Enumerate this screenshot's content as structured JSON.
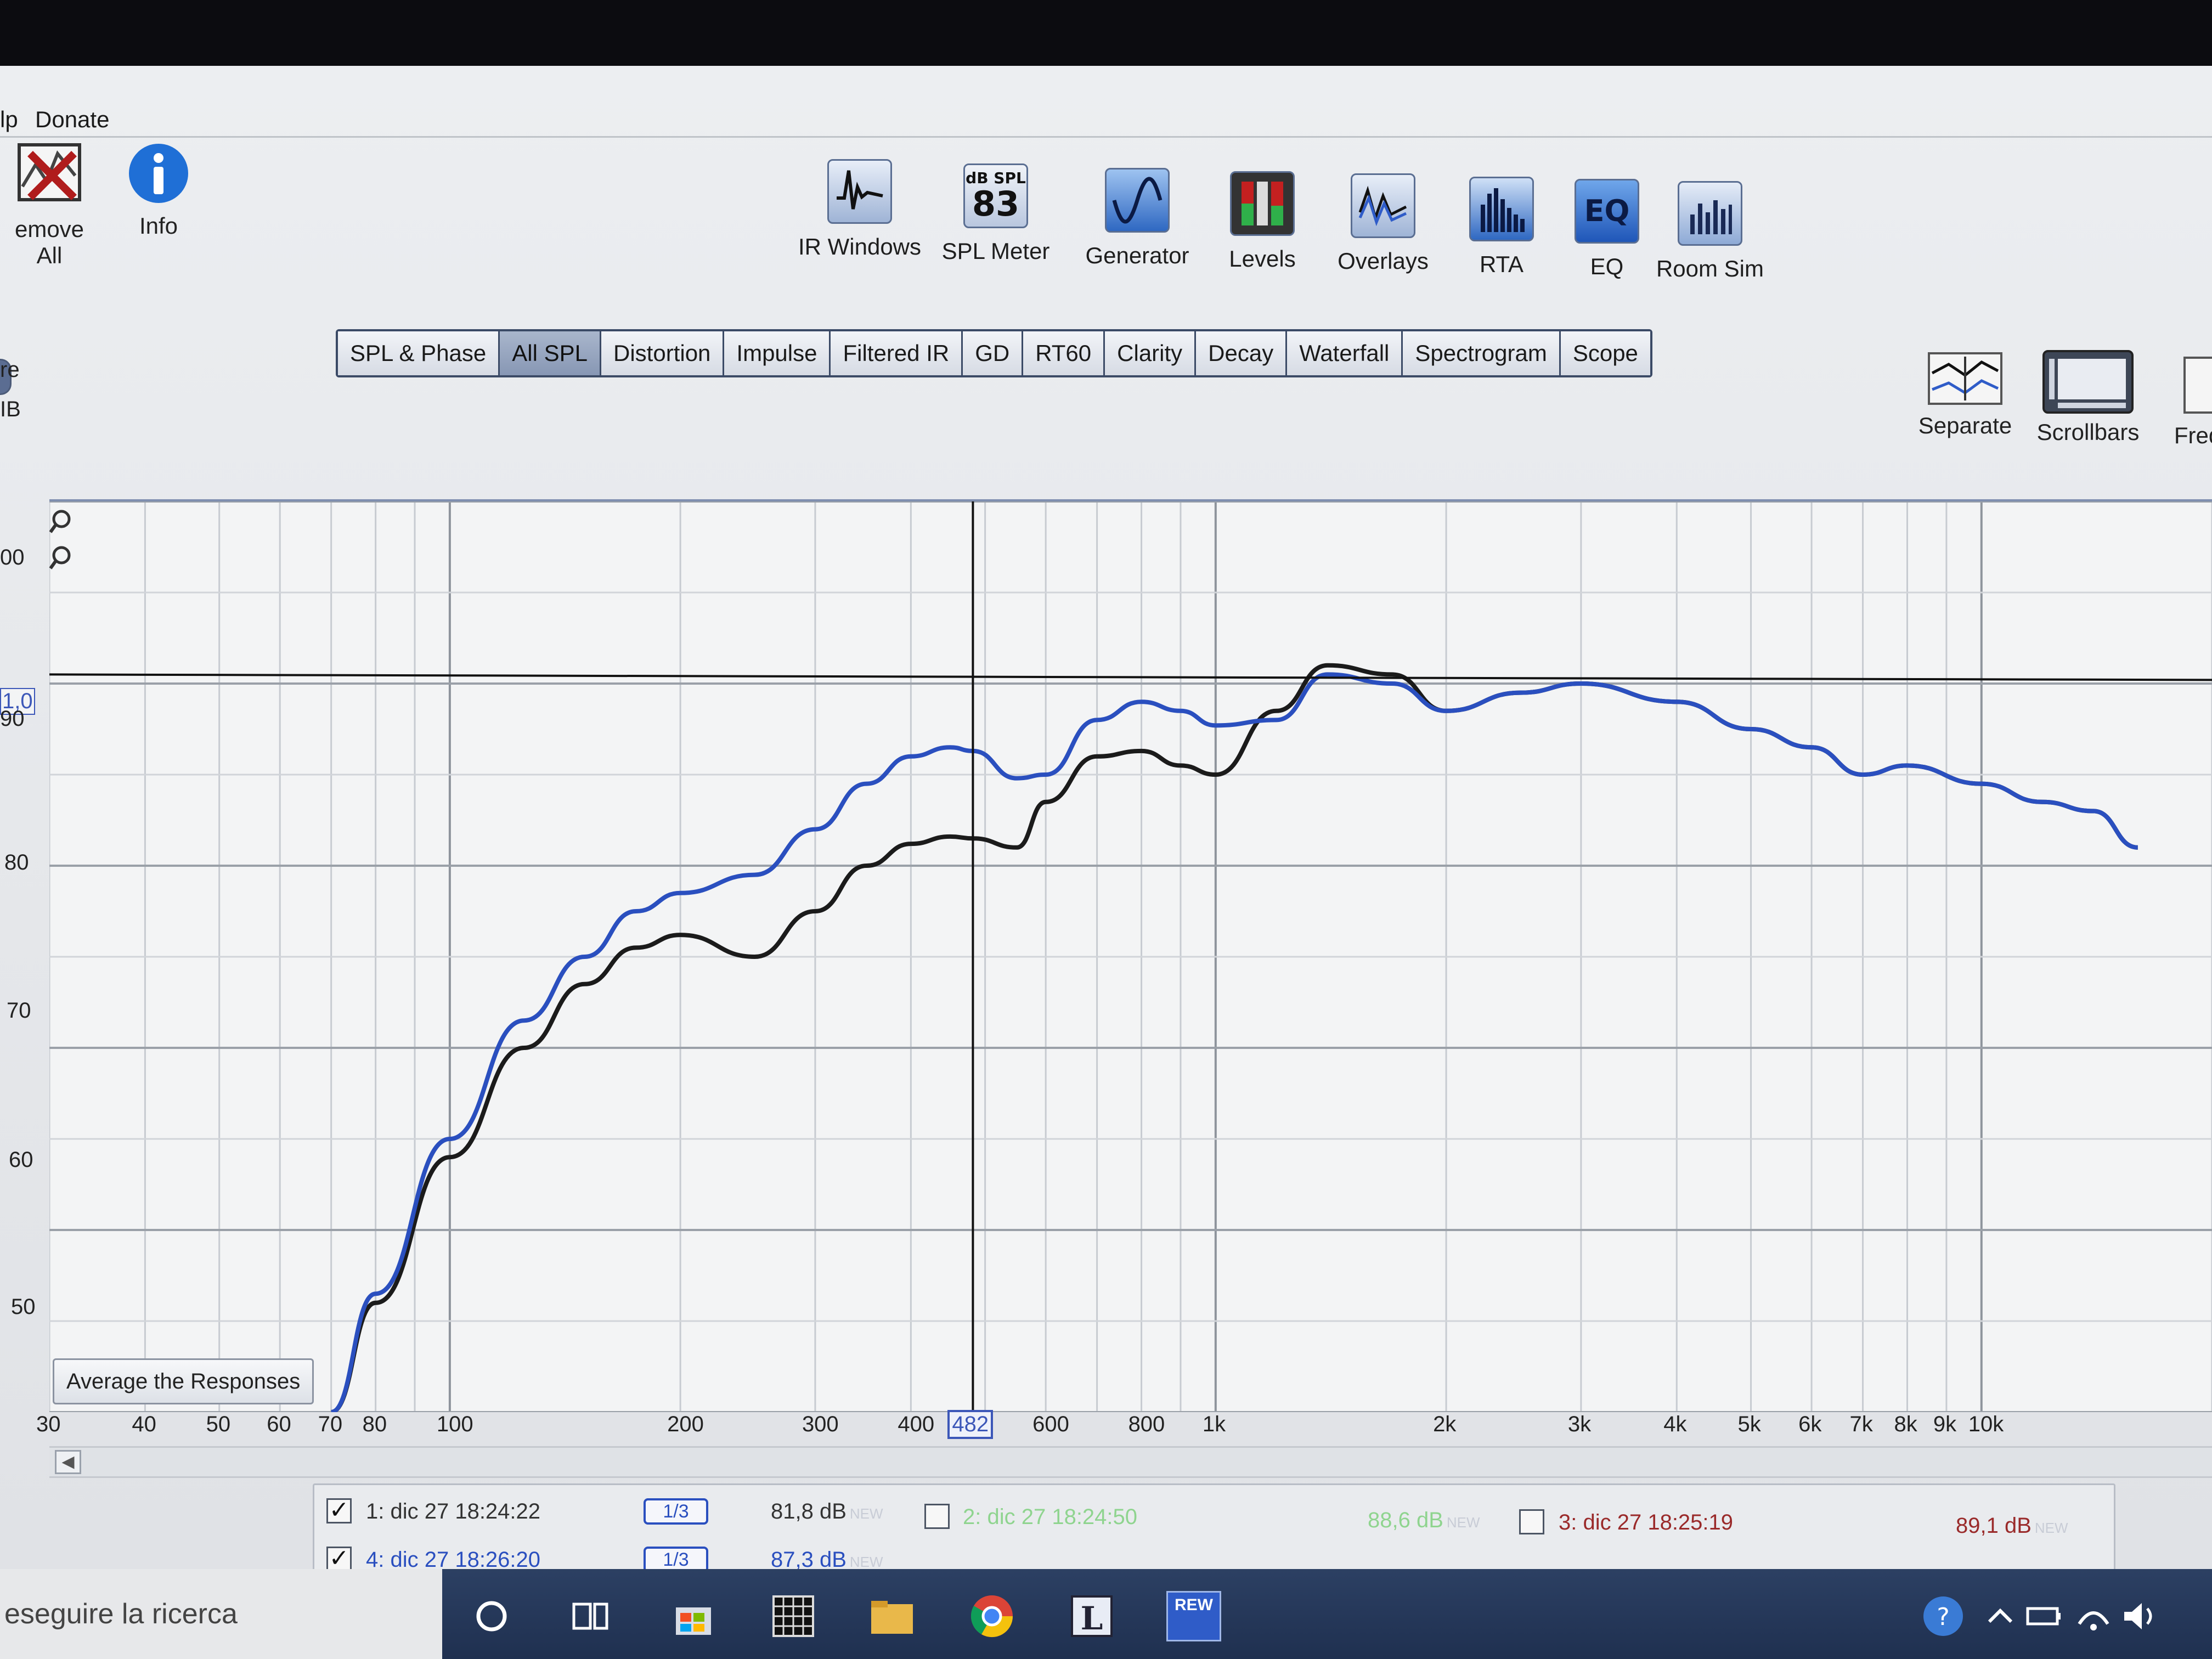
{
  "menu": {
    "help_partial": "lp",
    "donate": "Donate"
  },
  "left_toolbar": {
    "remove_all": "emove All",
    "info": "Info"
  },
  "tools": [
    {
      "label": "IR Windows"
    },
    {
      "label": "SPL Meter",
      "unit": "dB SPL",
      "value": "83"
    },
    {
      "label": "Generator"
    },
    {
      "label": "Levels"
    },
    {
      "label": "Overlays"
    },
    {
      "label": "RTA"
    },
    {
      "label": "EQ"
    },
    {
      "label": "Room Sim"
    }
  ],
  "tabs": [
    "SPL & Phase",
    "All SPL",
    "Distortion",
    "Impulse",
    "Filtered IR",
    "GD",
    "RT60",
    "Clarity",
    "Decay",
    "Waterfall",
    "Spectrogram",
    "Scope"
  ],
  "active_tab": "All SPL",
  "right_tools": {
    "separate": "Separate",
    "scrollbars": "Scrollbars",
    "freq_partial": "Freq"
  },
  "side_labels": {
    "re_partial": "re",
    "db_partial": "IB"
  },
  "graph": {
    "y_ticks": [
      "00",
      "1,0",
      "90",
      "80",
      "70",
      "60",
      "50"
    ],
    "x_ticks": [
      "30",
      "40",
      "50",
      "60",
      "70",
      "80",
      "100",
      "200",
      "300",
      "400",
      "600",
      "800",
      "1k",
      "2k",
      "3k",
      "4k",
      "5k",
      "6k",
      "7k",
      "8k",
      "9k",
      "10k"
    ],
    "cursor_freq": "482",
    "average_button": "Average the Responses"
  },
  "legend": [
    {
      "checked": true,
      "name": "1: dic 27 18:24:22",
      "smoothing": "1/3",
      "level": "81,8 dB",
      "color": "#1b1b1b"
    },
    {
      "checked": true,
      "name": "4: dic 27 18:26:20",
      "smoothing": "1/3",
      "level": "87,3 dB",
      "color": "#2a4fbf"
    },
    {
      "checked": false,
      "name": "2: dic 27 18:24:50",
      "level": "88,6 dB",
      "color": "#7fcf7f"
    },
    {
      "checked": false,
      "name": "3: dic 27 18:25:19",
      "level": "89,1 dB",
      "color": "#b03a3a"
    }
  ],
  "new_tag": "NEW",
  "taskbar": {
    "search_placeholder": "eseguire la ricerca",
    "rew_label": "REW"
  },
  "chart_data": {
    "type": "line",
    "x_scale": "log",
    "xlim": [
      30,
      20000
    ],
    "ylim": [
      50,
      100
    ],
    "x": [
      70,
      80,
      100,
      125,
      150,
      175,
      200,
      250,
      300,
      350,
      400,
      450,
      482,
      550,
      600,
      700,
      800,
      900,
      1000,
      1200,
      1400,
      1700,
      2000,
      2500,
      3000,
      4000,
      5000,
      6000,
      7000,
      8000,
      10000,
      12000,
      14000,
      16000
    ],
    "series": [
      {
        "name": "1: dic 27 18:24:22",
        "color": "#1b1b1b",
        "values": [
          50,
          56,
          64,
          70,
          73.5,
          75.5,
          76.2,
          75.0,
          77.5,
          80.0,
          81.2,
          81.6,
          81.5,
          81.0,
          83.5,
          86.0,
          86.3,
          85.5,
          85.0,
          88.5,
          91.0,
          90.5,
          88.5,
          89.5,
          90.0,
          89.0,
          87.5,
          86.5,
          85.0,
          85.5,
          84.5,
          83.5,
          83.0,
          81.0
        ]
      },
      {
        "name": "4: dic 27 18:26:20",
        "color": "#2a4fbf",
        "values": [
          50,
          56.5,
          65,
          71.5,
          75,
          77.5,
          78.5,
          79.5,
          82.0,
          84.5,
          86.0,
          86.5,
          86.3,
          84.8,
          85.0,
          88.0,
          89.0,
          88.5,
          87.7,
          88.0,
          90.5,
          90.0,
          88.5,
          89.5,
          90.0,
          89.0,
          87.5,
          86.5,
          85.0,
          85.5,
          84.5,
          83.5,
          83.0,
          81.0
        ]
      }
    ]
  }
}
